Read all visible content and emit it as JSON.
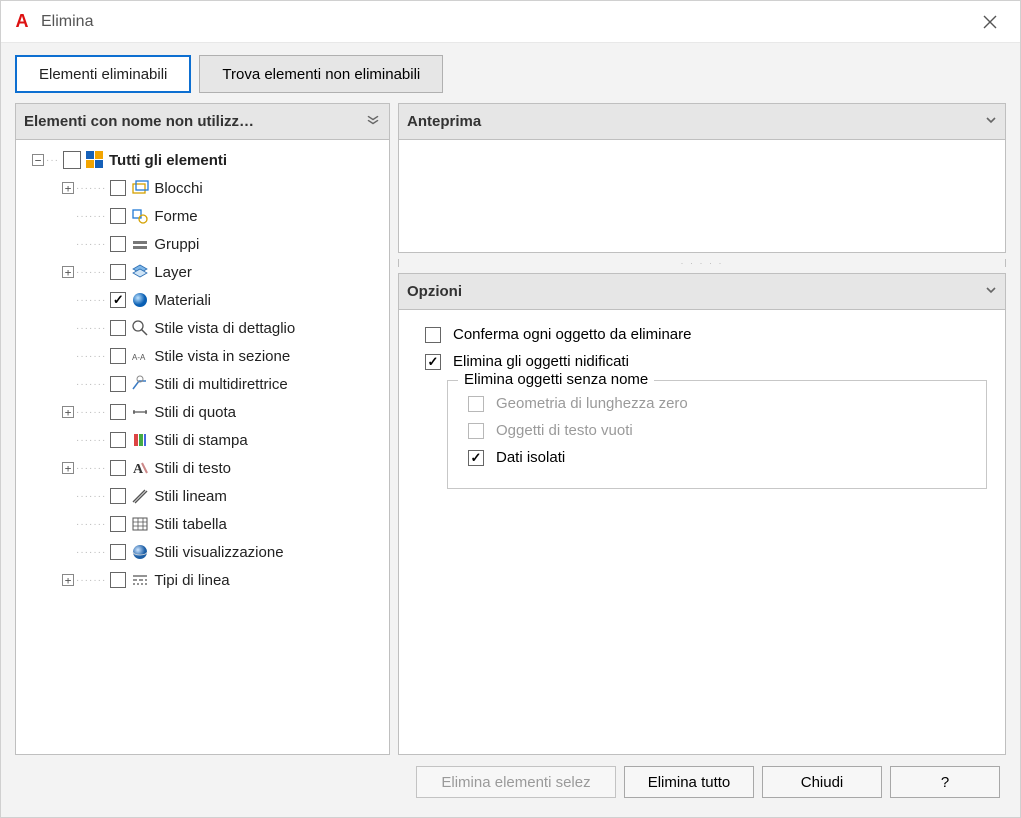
{
  "window": {
    "title": "Elimina"
  },
  "tabs": {
    "purgeable": "Elementi eliminabili",
    "nonpurgeable": "Trova elementi non eliminabili"
  },
  "leftPanel": {
    "header": "Elementi con nome non utilizz…",
    "root": "Tutti gli elementi",
    "items": [
      "Blocchi",
      "Forme",
      "Gruppi",
      "Layer",
      "Materiali",
      "Stile vista di dettaglio",
      "Stile vista in sezione",
      "Stili di multidirettrice",
      "Stili di quota",
      "Stili di stampa",
      "Stili di testo",
      "Stili lineam",
      "Stili tabella",
      "Stili visualizzazione",
      "Tipi di linea"
    ]
  },
  "preview": {
    "header": "Anteprima"
  },
  "options": {
    "header": "Opzioni",
    "confirm": "Conferma ogni oggetto da eliminare",
    "nested": "Elimina gli oggetti nidificati",
    "groupTitle": "Elimina oggetti senza nome",
    "zeroLen": "Geometria di lunghezza zero",
    "emptyText": "Oggetti di testo vuoti",
    "isolated": "Dati isolati"
  },
  "buttons": {
    "purgeSel": "Elimina elementi selez",
    "purgeAll": "Elimina tutto",
    "close": "Chiudi",
    "help": "?"
  }
}
